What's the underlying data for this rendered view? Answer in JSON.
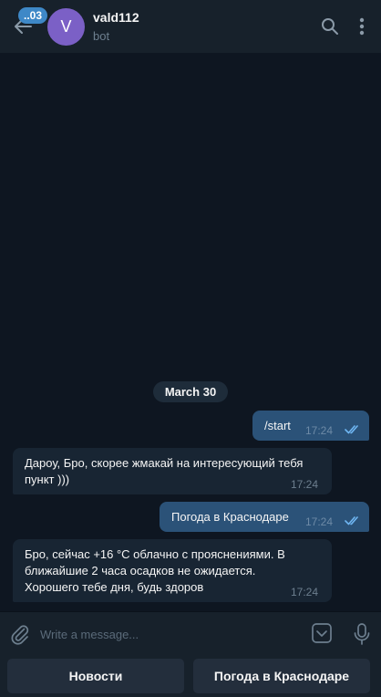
{
  "header": {
    "unread_count": "..03",
    "avatar_letter": "V",
    "title": "vald112",
    "subtitle": "bot"
  },
  "chat": {
    "date_separator": "March 30",
    "messages": [
      {
        "direction": "out",
        "text": "/start",
        "time": "17:24",
        "read": true
      },
      {
        "direction": "in",
        "text": "Дароу, Бро, скорее жмакай на интересующий тебя\nпункт )))",
        "time": "17:24"
      },
      {
        "direction": "out",
        "text": "Погода в Краснодаре",
        "time": "17:24",
        "read": true
      },
      {
        "direction": "in",
        "text": "Бро, сейчас +16 °С облачно с прояснениями. В\nближайшие 2 часа осадков не ожидается.\nХорошего тебе дня, будь здоров",
        "time": "17:24"
      }
    ]
  },
  "composer": {
    "placeholder": "Write a message..."
  },
  "keyboard": {
    "buttons": [
      "Новости",
      "Погода в Краснодаре"
    ]
  },
  "colors": {
    "background": "#0e1621",
    "panel": "#17212b",
    "outgoing_bubble": "#2b5278",
    "incoming_bubble": "#182533",
    "accent": "#3e88c7",
    "avatar": "#7b60c6"
  },
  "icons": [
    "back-arrow-icon",
    "search-icon",
    "more-vertical-icon",
    "read-check-icon",
    "paperclip-icon",
    "keyboard-toggle-icon",
    "microphone-icon"
  ]
}
